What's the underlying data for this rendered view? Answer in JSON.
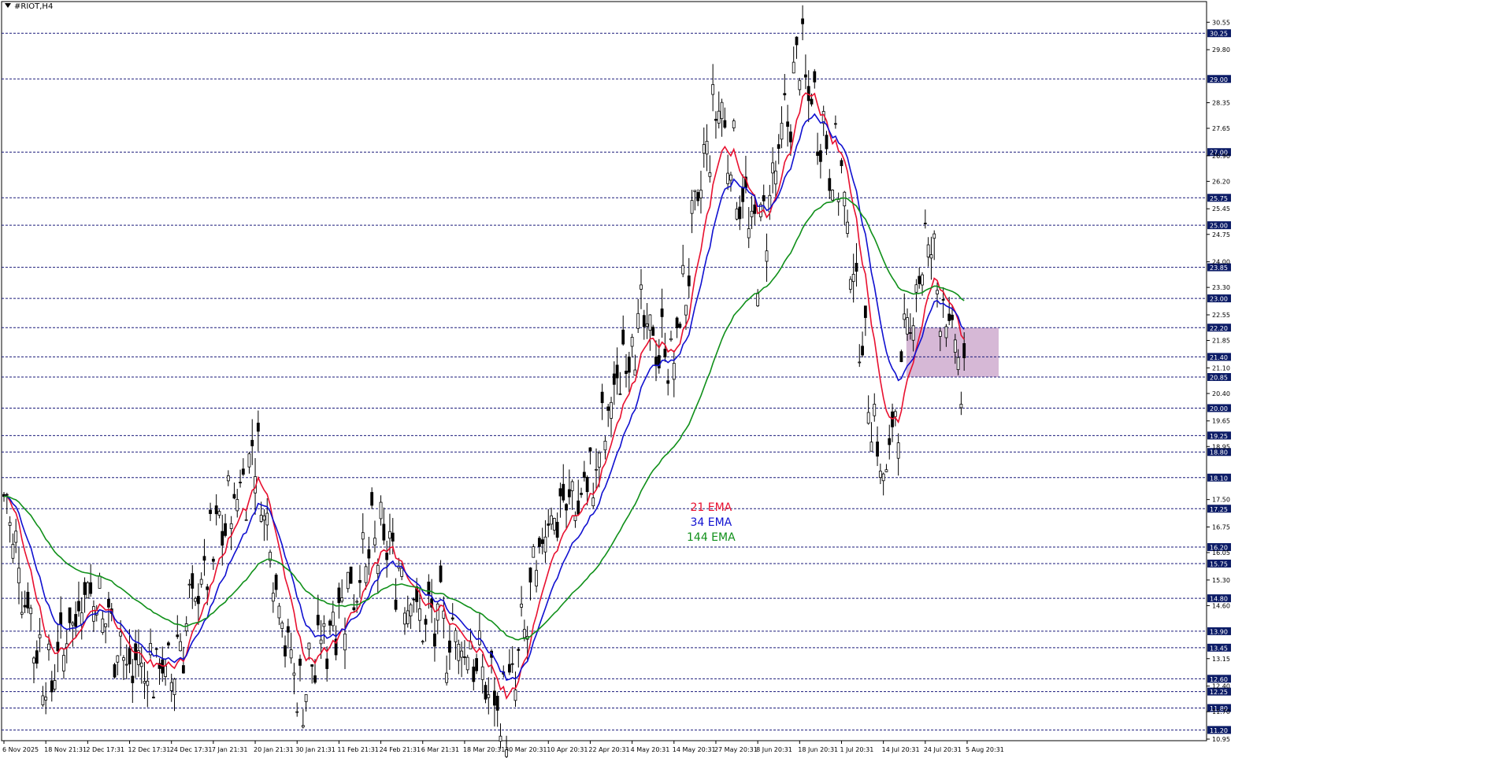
{
  "header": {
    "title": "#RIOT,H4"
  },
  "colors": {
    "ema21": "#e8102f",
    "ema34": "#1010d0",
    "ema144": "#10901a",
    "candle": "#000000",
    "grid": "#1a1a7a",
    "highlight": "#c8a0c8",
    "label_bg": "#0b1b66"
  },
  "legend": [
    {
      "label": "21 EMA",
      "color": "#e8102f"
    },
    {
      "label": "34 EMA",
      "color": "#1010d0"
    },
    {
      "label": "144 EMA",
      "color": "#10901a"
    }
  ],
  "chart_data": {
    "type": "candlestick",
    "title": "#RIOT,H4",
    "ylim": [
      10.95,
      30.9
    ],
    "y_ticks": [
      "30.55",
      "29.80",
      "28.35",
      "27.65",
      "26.90",
      "26.20",
      "25.45",
      "24.75",
      "24.00",
      "23.30",
      "22.55",
      "21.85",
      "21.10",
      "20.40",
      "19.65",
      "18.95",
      "17.50",
      "16.75",
      "16.05",
      "15.30",
      "14.60",
      "13.15",
      "12.40",
      "11.70",
      "10.95"
    ],
    "levels": [
      "30.25",
      "29.00",
      "27.00",
      "25.75",
      "25.00",
      "23.85",
      "23.00",
      "22.20",
      "21.40",
      "20.85",
      "20.00",
      "19.25",
      "18.80",
      "18.10",
      "17.25",
      "16.20",
      "15.75",
      "14.80",
      "13.90",
      "13.45",
      "12.60",
      "12.25",
      "11.80",
      "11.20"
    ],
    "x_labels": [
      "6 Nov 2025",
      "18 Nov 21:31",
      "2 Dec 17:31",
      "12 Dec 17:31",
      "24 Dec 17:31",
      "7 Jan 21:31",
      "20 Jan 21:31",
      "30 Jan 21:31",
      "11 Feb 21:31",
      "24 Feb 21:31",
      "6 Mar 21:31",
      "18 Mar 20:31",
      "30 Mar 20:31",
      "10 Apr 20:31",
      "22 Apr 20:31",
      "4 May 20:31",
      "14 May 20:31",
      "27 May 20:31",
      "8 Jun 20:31",
      "18 Jun 20:31",
      "1 Jul 20:31",
      "14 Jul 20:31",
      "24 Jul 20:31",
      "5 Aug 20:31"
    ],
    "price_path": [
      [
        "6 Nov 2025",
        17.6
      ],
      [
        "18 Nov 21:31",
        12.4
      ],
      [
        "2 Dec 17:31",
        15.3
      ],
      [
        "12 Dec 17:31",
        13.0
      ],
      [
        "24 Dec 17:31",
        12.9
      ],
      [
        "7 Jan 21:31",
        16.2
      ],
      [
        "20 Jan 21:31",
        18.8
      ],
      [
        "30 Jan 21:31",
        12.0
      ],
      [
        "11 Feb 21:31",
        14.6
      ],
      [
        "24 Feb 21:31",
        16.5
      ],
      [
        "6 Mar 21:31",
        14.3
      ],
      [
        "18 Mar 20:31",
        13.6
      ],
      [
        "30 Mar 20:31",
        11.5
      ],
      [
        "10 Apr 20:31",
        17.0
      ],
      [
        "22 Apr 20:31",
        17.8
      ],
      [
        "4 May 20:31",
        22.3
      ],
      [
        "14 May 20:31",
        21.5
      ],
      [
        "27 May 20:31",
        28.5
      ],
      [
        "8 Jun 20:31",
        24.2
      ],
      [
        "18 Jun 20:31",
        29.5
      ],
      [
        "1 Jul 20:31",
        26.0
      ],
      [
        "14 Jul 20:31",
        17.8
      ],
      [
        "24 Jul 20:31",
        24.8
      ],
      [
        "5 Aug 20:31",
        20.2
      ]
    ],
    "series": [
      {
        "name": "21 EMA"
      },
      {
        "name": "34 EMA"
      },
      {
        "name": "144 EMA"
      }
    ],
    "highlight_zone": {
      "y_range": [
        20.85,
        22.2
      ],
      "x_range": [
        "24 Jul 20:31",
        "5 Aug 20:31"
      ]
    },
    "grid": "horizontal dashed at levels",
    "legend_position": "center-bottom"
  }
}
